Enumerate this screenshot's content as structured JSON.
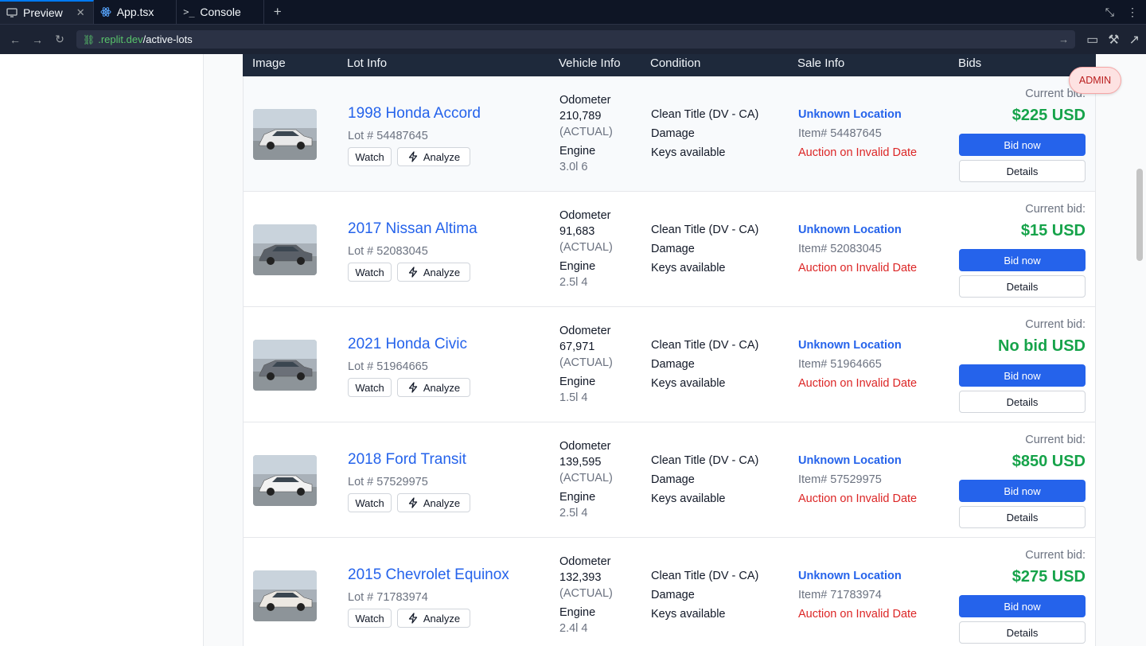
{
  "tabs": [
    {
      "label": "Preview",
      "icon": "monitor-icon",
      "active": true
    },
    {
      "label": "App.tsx",
      "icon": "react-icon",
      "active": false
    },
    {
      "label": "Console",
      "icon": "terminal-icon",
      "active": false
    }
  ],
  "address": {
    "host": ".replit.dev",
    "path": "/active-lots"
  },
  "table": {
    "headers": {
      "image": "Image",
      "lot_info": "Lot Info",
      "vehicle_info": "Vehicle Info",
      "condition": "Condition",
      "sale_info": "Sale Info",
      "bids": "Bids"
    }
  },
  "admin_label": "ADMIN",
  "labels": {
    "watch": "Watch",
    "analyze": "Analyze",
    "odometer": "Odometer",
    "actual": "(ACTUAL)",
    "engine": "Engine",
    "current_bid": "Current bid:",
    "bid_now": "Bid now",
    "details": "Details"
  },
  "lots": [
    {
      "title": "1998 Honda Accord",
      "lot": "Lot # 54487645",
      "odometer": "210,789",
      "engine": "3.0l 6",
      "title_status": "Clean Title (DV - CA)",
      "damage": "Damage",
      "keys": "Keys available",
      "location": "Unknown Location",
      "item": "Item# 54487645",
      "auction": "Auction on Invalid Date",
      "bid": "$225 USD",
      "car_color": "#e8e8e8"
    },
    {
      "title": "2017 Nissan Altima",
      "lot": "Lot # 52083045",
      "odometer": "91,683",
      "engine": "2.5l 4",
      "title_status": "Clean Title (DV - CA)",
      "damage": "Damage",
      "keys": "Keys available",
      "location": "Unknown Location",
      "item": "Item# 52083045",
      "auction": "Auction on Invalid Date",
      "bid": "$15 USD",
      "car_color": "#5a6068"
    },
    {
      "title": "2021 Honda Civic",
      "lot": "Lot # 51964665",
      "odometer": "67,971",
      "engine": "1.5l 4",
      "title_status": "Clean Title (DV - CA)",
      "damage": "Damage",
      "keys": "Keys available",
      "location": "Unknown Location",
      "item": "Item# 51964665",
      "auction": "Auction on Invalid Date",
      "bid": "No bid USD",
      "car_color": "#6b7078"
    },
    {
      "title": "2018 Ford Transit",
      "lot": "Lot # 57529975",
      "odometer": "139,595",
      "engine": "2.5l 4",
      "title_status": "Clean Title (DV - CA)",
      "damage": "Damage",
      "keys": "Keys available",
      "location": "Unknown Location",
      "item": "Item# 57529975",
      "auction": "Auction on Invalid Date",
      "bid": "$850 USD",
      "car_color": "#f2f2f2"
    },
    {
      "title": "2015 Chevrolet Equinox",
      "lot": "Lot # 71783974",
      "odometer": "132,393",
      "engine": "2.4l 4",
      "title_status": "Clean Title (DV - CA)",
      "damage": "Damage",
      "keys": "Keys available",
      "location": "Unknown Location",
      "item": "Item# 71783974",
      "auction": "Auction on Invalid Date",
      "bid": "$275 USD",
      "car_color": "#ece8e2"
    }
  ]
}
